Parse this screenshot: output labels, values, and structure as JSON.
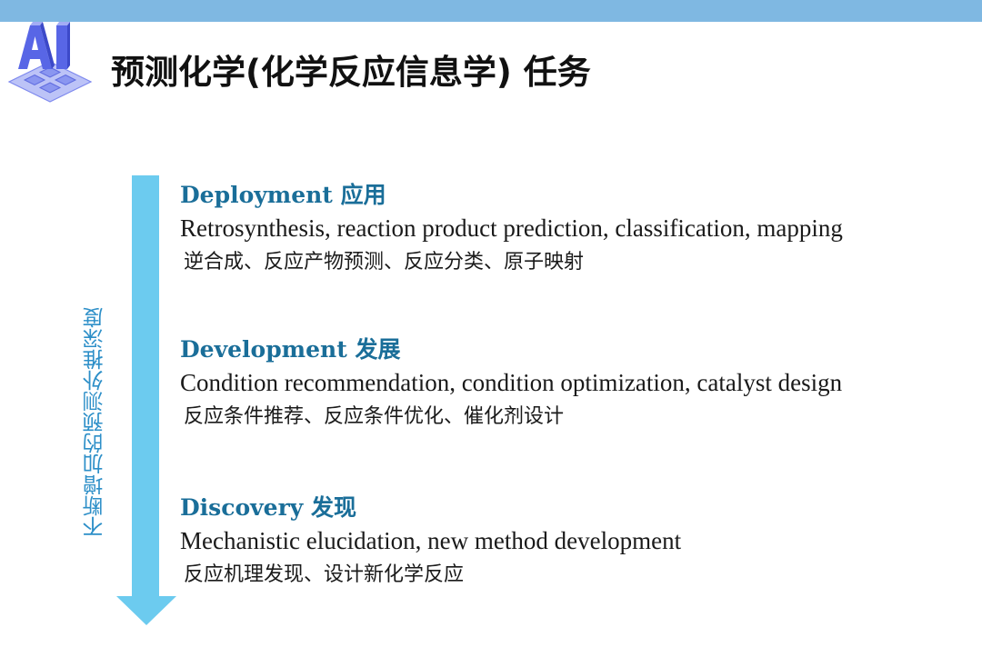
{
  "header": {
    "title": "预测化学(化学反应信息学) 任务",
    "logo_icon": "ai-logo-icon"
  },
  "side_label": "不断增加的预测外推深度",
  "sections": [
    {
      "title_en": "Deployment",
      "title_zh": "应用",
      "desc_en": "Retrosynthesis, reaction product prediction, classification, mapping",
      "desc_zh": "逆合成、反应产物预测、反应分类、原子映射"
    },
    {
      "title_en": "Development",
      "title_zh": "发展",
      "desc_en": "Condition recommendation, condition optimization, catalyst design",
      "desc_zh": "反应条件推荐、反应条件优化、催化剂设计"
    },
    {
      "title_en": "Discovery",
      "title_zh": "发现",
      "desc_en": "Mechanistic elucidation, new method development",
      "desc_zh": "反应机理发现、设计新化学反应"
    }
  ],
  "colors": {
    "top_bar": "#7fb8e2",
    "arrow": "#6ccbef",
    "heading": "#1a6e99",
    "side_label": "#2d8fc8"
  }
}
